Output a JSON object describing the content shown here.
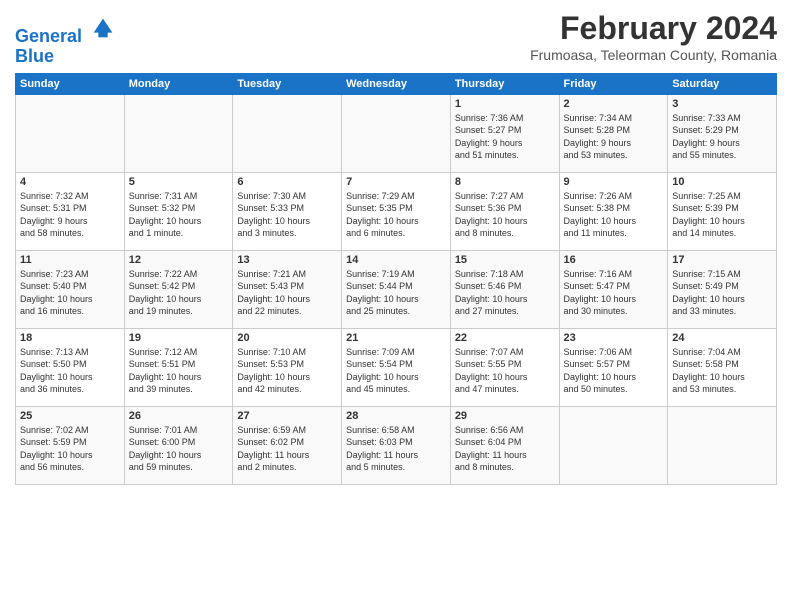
{
  "header": {
    "logo_line1": "General",
    "logo_line2": "Blue",
    "title": "February 2024",
    "subtitle": "Frumoasa, Teleorman County, Romania"
  },
  "weekdays": [
    "Sunday",
    "Monday",
    "Tuesday",
    "Wednesday",
    "Thursday",
    "Friday",
    "Saturday"
  ],
  "weeks": [
    [
      {
        "day": "",
        "info": ""
      },
      {
        "day": "",
        "info": ""
      },
      {
        "day": "",
        "info": ""
      },
      {
        "day": "",
        "info": ""
      },
      {
        "day": "1",
        "info": "Sunrise: 7:36 AM\nSunset: 5:27 PM\nDaylight: 9 hours\nand 51 minutes."
      },
      {
        "day": "2",
        "info": "Sunrise: 7:34 AM\nSunset: 5:28 PM\nDaylight: 9 hours\nand 53 minutes."
      },
      {
        "day": "3",
        "info": "Sunrise: 7:33 AM\nSunset: 5:29 PM\nDaylight: 9 hours\nand 55 minutes."
      }
    ],
    [
      {
        "day": "4",
        "info": "Sunrise: 7:32 AM\nSunset: 5:31 PM\nDaylight: 9 hours\nand 58 minutes."
      },
      {
        "day": "5",
        "info": "Sunrise: 7:31 AM\nSunset: 5:32 PM\nDaylight: 10 hours\nand 1 minute."
      },
      {
        "day": "6",
        "info": "Sunrise: 7:30 AM\nSunset: 5:33 PM\nDaylight: 10 hours\nand 3 minutes."
      },
      {
        "day": "7",
        "info": "Sunrise: 7:29 AM\nSunset: 5:35 PM\nDaylight: 10 hours\nand 6 minutes."
      },
      {
        "day": "8",
        "info": "Sunrise: 7:27 AM\nSunset: 5:36 PM\nDaylight: 10 hours\nand 8 minutes."
      },
      {
        "day": "9",
        "info": "Sunrise: 7:26 AM\nSunset: 5:38 PM\nDaylight: 10 hours\nand 11 minutes."
      },
      {
        "day": "10",
        "info": "Sunrise: 7:25 AM\nSunset: 5:39 PM\nDaylight: 10 hours\nand 14 minutes."
      }
    ],
    [
      {
        "day": "11",
        "info": "Sunrise: 7:23 AM\nSunset: 5:40 PM\nDaylight: 10 hours\nand 16 minutes."
      },
      {
        "day": "12",
        "info": "Sunrise: 7:22 AM\nSunset: 5:42 PM\nDaylight: 10 hours\nand 19 minutes."
      },
      {
        "day": "13",
        "info": "Sunrise: 7:21 AM\nSunset: 5:43 PM\nDaylight: 10 hours\nand 22 minutes."
      },
      {
        "day": "14",
        "info": "Sunrise: 7:19 AM\nSunset: 5:44 PM\nDaylight: 10 hours\nand 25 minutes."
      },
      {
        "day": "15",
        "info": "Sunrise: 7:18 AM\nSunset: 5:46 PM\nDaylight: 10 hours\nand 27 minutes."
      },
      {
        "day": "16",
        "info": "Sunrise: 7:16 AM\nSunset: 5:47 PM\nDaylight: 10 hours\nand 30 minutes."
      },
      {
        "day": "17",
        "info": "Sunrise: 7:15 AM\nSunset: 5:49 PM\nDaylight: 10 hours\nand 33 minutes."
      }
    ],
    [
      {
        "day": "18",
        "info": "Sunrise: 7:13 AM\nSunset: 5:50 PM\nDaylight: 10 hours\nand 36 minutes."
      },
      {
        "day": "19",
        "info": "Sunrise: 7:12 AM\nSunset: 5:51 PM\nDaylight: 10 hours\nand 39 minutes."
      },
      {
        "day": "20",
        "info": "Sunrise: 7:10 AM\nSunset: 5:53 PM\nDaylight: 10 hours\nand 42 minutes."
      },
      {
        "day": "21",
        "info": "Sunrise: 7:09 AM\nSunset: 5:54 PM\nDaylight: 10 hours\nand 45 minutes."
      },
      {
        "day": "22",
        "info": "Sunrise: 7:07 AM\nSunset: 5:55 PM\nDaylight: 10 hours\nand 47 minutes."
      },
      {
        "day": "23",
        "info": "Sunrise: 7:06 AM\nSunset: 5:57 PM\nDaylight: 10 hours\nand 50 minutes."
      },
      {
        "day": "24",
        "info": "Sunrise: 7:04 AM\nSunset: 5:58 PM\nDaylight: 10 hours\nand 53 minutes."
      }
    ],
    [
      {
        "day": "25",
        "info": "Sunrise: 7:02 AM\nSunset: 5:59 PM\nDaylight: 10 hours\nand 56 minutes."
      },
      {
        "day": "26",
        "info": "Sunrise: 7:01 AM\nSunset: 6:00 PM\nDaylight: 10 hours\nand 59 minutes."
      },
      {
        "day": "27",
        "info": "Sunrise: 6:59 AM\nSunset: 6:02 PM\nDaylight: 11 hours\nand 2 minutes."
      },
      {
        "day": "28",
        "info": "Sunrise: 6:58 AM\nSunset: 6:03 PM\nDaylight: 11 hours\nand 5 minutes."
      },
      {
        "day": "29",
        "info": "Sunrise: 6:56 AM\nSunset: 6:04 PM\nDaylight: 11 hours\nand 8 minutes."
      },
      {
        "day": "",
        "info": ""
      },
      {
        "day": "",
        "info": ""
      }
    ]
  ]
}
